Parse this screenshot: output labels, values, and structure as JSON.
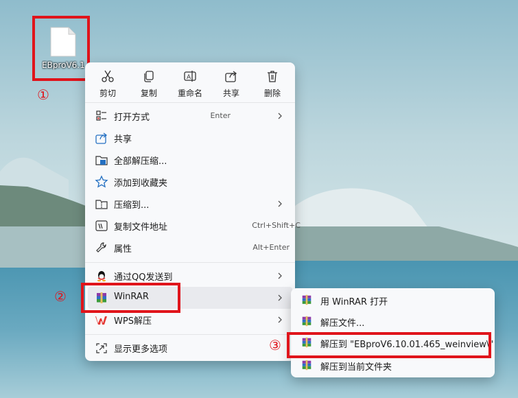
{
  "desktop": {
    "file_name": "EBproV6.1",
    "step_markers": [
      "①",
      "②",
      "③"
    ]
  },
  "quick_actions": [
    {
      "label": "剪切",
      "icon": "scissors-icon"
    },
    {
      "label": "复制",
      "icon": "copy-icon"
    },
    {
      "label": "重命名",
      "icon": "rename-icon"
    },
    {
      "label": "共享",
      "icon": "share-icon"
    },
    {
      "label": "删除",
      "icon": "trash-icon"
    }
  ],
  "menu": {
    "items": [
      {
        "label": "打开方式",
        "shortcut": "Enter",
        "icon": "open-with-icon"
      },
      {
        "label": "共享",
        "shortcut": "",
        "icon": "share-icon"
      },
      {
        "label": "全部解压缩...",
        "shortcut": "",
        "icon": "extract-all-icon"
      },
      {
        "label": "添加到收藏夹",
        "shortcut": "",
        "icon": "star-icon"
      },
      {
        "label": "压缩到...",
        "shortcut": "",
        "icon": "zip-folder-icon"
      },
      {
        "label": "复制文件地址",
        "shortcut": "Ctrl+Shift+C",
        "icon": "copy-path-icon"
      },
      {
        "label": "属性",
        "shortcut": "Alt+Enter",
        "icon": "wrench-icon"
      },
      {
        "label": "通过QQ发送到",
        "shortcut": "",
        "icon": "qq-icon"
      },
      {
        "label": "WinRAR",
        "shortcut": "",
        "icon": "winrar-icon"
      },
      {
        "label": "WPS解压",
        "shortcut": "",
        "icon": "wps-icon"
      },
      {
        "label": "显示更多选项",
        "shortcut": "",
        "icon": "more-options-icon"
      }
    ]
  },
  "submenu": {
    "items": [
      {
        "label": "用 WinRAR 打开",
        "icon": "winrar-icon"
      },
      {
        "label": "解压文件...",
        "icon": "winrar-icon"
      },
      {
        "label": "解压到 \"EBproV6.10.01.465_weinview\\\"",
        "icon": "winrar-icon"
      },
      {
        "label": "解压到当前文件夹",
        "icon": "winrar-icon"
      }
    ]
  },
  "colors": {
    "annotation_red": "#e0141b",
    "menu_bg": "#f8f9fb",
    "highlight": "#e9eaee"
  }
}
